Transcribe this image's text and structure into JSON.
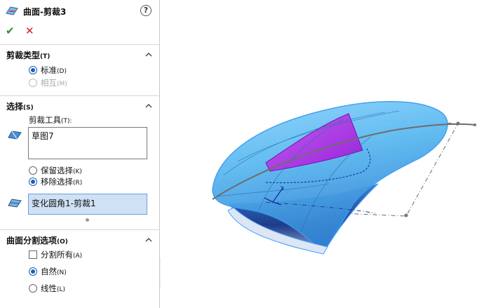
{
  "header": {
    "title": "曲面-剪裁3",
    "help_symbol": "?",
    "icon": "surface-trim-icon"
  },
  "actions": {
    "ok_symbol": "✔",
    "cancel_symbol": "✕"
  },
  "trim_type": {
    "title": "剪裁类型",
    "title_key": "(T)",
    "options": [
      {
        "label": "标准",
        "key": "(D)",
        "selected": true,
        "enabled": true
      },
      {
        "label": "相互",
        "key": "(M)",
        "selected": false,
        "enabled": false
      }
    ]
  },
  "selection": {
    "title": "选择",
    "title_key": "(S)",
    "trim_tool_label": "剪裁工具",
    "trim_tool_key": "(T):",
    "trim_tool_items": [
      "草图7"
    ],
    "keep_option": {
      "label": "保留选择",
      "key": "(K)",
      "selected": false
    },
    "remove_option": {
      "label": "移除选择",
      "key": "(R)",
      "selected": true
    },
    "pieces_items": [
      "变化圆角1-剪裁1"
    ]
  },
  "split_options": {
    "title": "曲面分割选项",
    "title_key": "(O)",
    "split_all": {
      "label": "分割所有",
      "key": "(A)",
      "checked": false
    },
    "natural": {
      "label": "自然",
      "key": "(N)",
      "selected": true
    },
    "linear": {
      "label": "线性",
      "key": "(L)",
      "selected": false
    }
  },
  "colors": {
    "surface_blue": "#5ab8f0",
    "trim_magenta": "#b238e8",
    "accent_blue": "#1a5fb4",
    "ok_green": "#2a8f2a",
    "cancel_red": "#d42020"
  }
}
